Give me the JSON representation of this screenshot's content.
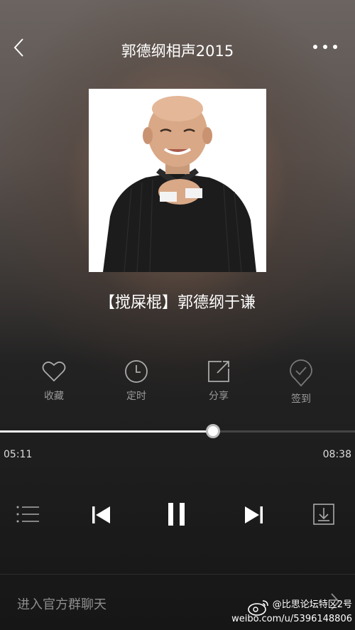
{
  "header": {
    "title": "郭德纲相声2015"
  },
  "track": {
    "title": "【搅屎棍】郭德纲于谦"
  },
  "actions": [
    {
      "label": "收藏",
      "icon": "heart-icon"
    },
    {
      "label": "定时",
      "icon": "clock-icon"
    },
    {
      "label": "分享",
      "icon": "share-icon"
    },
    {
      "label": "签到",
      "icon": "check-in-icon"
    }
  ],
  "progress": {
    "elapsed": "05:11",
    "total": "08:38",
    "fraction": 0.6
  },
  "controls": {
    "playlist_icon": "playlist-icon",
    "prev_icon": "previous-icon",
    "play_state_icon": "pause-icon",
    "next_icon": "next-icon",
    "download_icon": "download-icon"
  },
  "footer": {
    "text": "进入官方群聊天"
  },
  "watermark": {
    "line1": "@比思论坛特区2号",
    "line2": "weibo.com/u/5396148806"
  }
}
